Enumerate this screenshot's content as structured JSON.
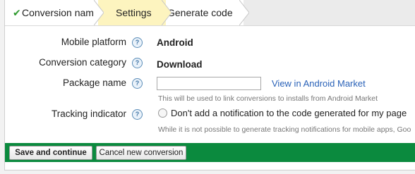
{
  "wizard": {
    "steps": [
      {
        "label": "Conversion name",
        "state": "completed",
        "icon": "checkmark-icon"
      },
      {
        "label": "Settings",
        "state": "current"
      },
      {
        "label": "Generate code",
        "state": "upcoming"
      }
    ]
  },
  "form": {
    "help_glyph": "?",
    "mobile_platform": {
      "label": "Mobile platform",
      "value": "Android"
    },
    "conversion_category": {
      "label": "Conversion category",
      "value": "Download"
    },
    "package_name": {
      "label": "Package name",
      "value": "",
      "link": "View in Android Market",
      "hint": "This will be used to link conversions to installs from Android Market"
    },
    "tracking_indicator": {
      "label": "Tracking indicator",
      "option": "Don't add a notification to the code generated for my page",
      "checked": false,
      "hint": "While it is not possible to generate tracking notifications for mobile apps, Goo"
    }
  },
  "footer": {
    "save_label": "Save and continue",
    "cancel_label": "Cancel new conversion"
  },
  "colors": {
    "current_step": "#fdf4bf",
    "footer_bar": "#0b8a3e",
    "link": "#2a62b8",
    "check": "#2e9a2e"
  }
}
